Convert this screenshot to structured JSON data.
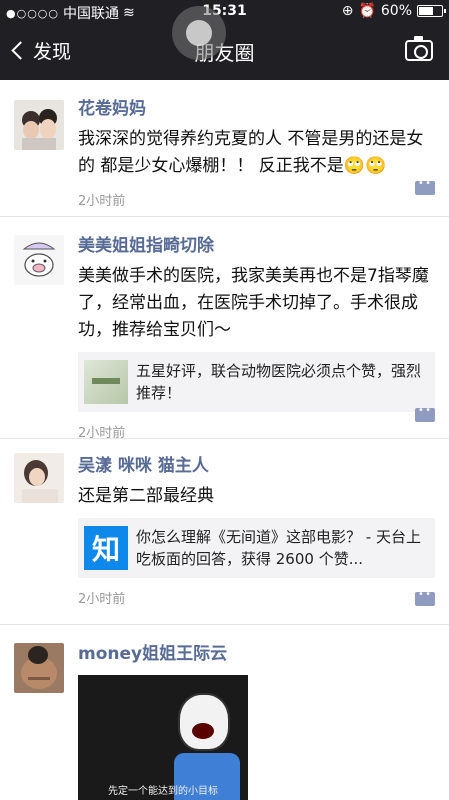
{
  "status": {
    "carrier": "中国联通",
    "time": "15:31",
    "battery": "60%",
    "battery_level": 0.6
  },
  "nav": {
    "back_label": "发现",
    "title": "朋友圈"
  },
  "posts": [
    {
      "user": "花卷妈妈",
      "text": "我深深的觉得养约克夏的人 不管是男的还是女的 都是少女心爆棚！！ 反正我不是🙄🙄",
      "time": "2小时前"
    },
    {
      "user": "美美姐姐指畸切除",
      "text": "美美做手术的医院，我家美美再也不是7指琴魔了，经常出血，在医院手术切掉了。手术很成功，推荐给宝贝们～",
      "share": "五星好评，联合动物医院必须点个赞，强烈推荐！",
      "time": "2小时前"
    },
    {
      "user": "吴漾 咪咪 猫主人",
      "text": "还是第二部最经典",
      "share": "你怎么理解《无间道》这部电影？ - 天台上吃板面的回答，获得 2600 个赞...",
      "share_icon": "知",
      "time": "2小时前"
    },
    {
      "user": "money姐姐王际云",
      "photo_caption": "先定一个能达到的小目标"
    }
  ]
}
